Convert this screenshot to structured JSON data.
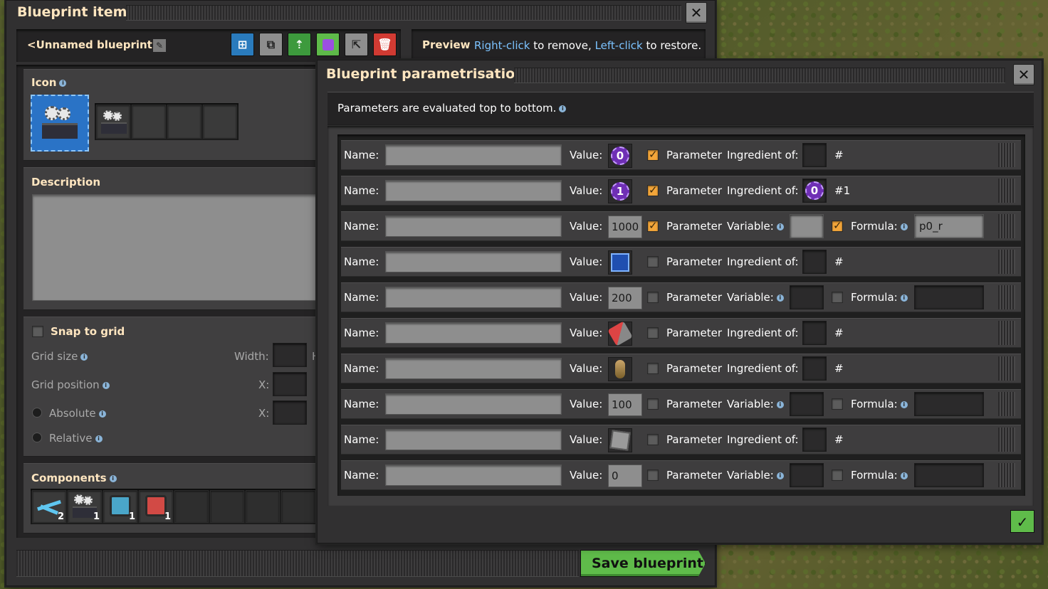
{
  "bp_window": {
    "title": "Blueprint item",
    "close": "✕",
    "blueprint_name": "<Unnamed blueprint>",
    "preview_label": "Preview",
    "preview_right_click": "Right-click",
    "preview_mid": "to remove,",
    "preview_left_click": "Left-click",
    "preview_end": "to restore.",
    "icon_header": "Icon",
    "description_header": "Description",
    "snap_to_grid": "Snap to grid",
    "grid_size": "Grid size",
    "width_label": "Width:",
    "h_label": "H",
    "grid_position": "Grid position",
    "x_label": "X:",
    "absolute": "Absolute",
    "relative": "Relative",
    "components_header": "Components",
    "components": [
      {
        "icon": "inserter-icon",
        "count": "2"
      },
      {
        "icon": "assembler-icon",
        "count": "1"
      },
      {
        "icon": "blue-machine-icon",
        "count": "1"
      },
      {
        "icon": "red-machine-icon",
        "count": "1"
      }
    ],
    "save_button": "Save blueprint"
  },
  "param_window": {
    "title": "Blueprint parametrisation",
    "close": "✕",
    "hint": "Parameters are evaluated top to bottom.",
    "confirm": "✓",
    "labels": {
      "name": "Name:",
      "value": "Value:",
      "parameter": "Parameter",
      "ingredient_of": "Ingredient of:",
      "variable": "Variable:",
      "formula": "Formula:",
      "hash": "#"
    },
    "rows": [
      {
        "value_type": "signal",
        "value": "0",
        "parameter": true,
        "mode": "ingredient",
        "ingredient_value": "",
        "hash": "#"
      },
      {
        "value_type": "signal",
        "value": "1",
        "parameter": true,
        "mode": "ingredient",
        "ingredient_value": "0",
        "hash": "#1"
      },
      {
        "value_type": "number",
        "value": "1000",
        "parameter": true,
        "mode": "variable",
        "variable_checked": true,
        "formula": "p0_r"
      },
      {
        "value_type": "item",
        "value_icon": "blueprint-combinator-icon",
        "parameter": false,
        "mode": "ingredient",
        "hash": "#"
      },
      {
        "value_type": "number",
        "value": "200",
        "parameter": false,
        "mode": "variable",
        "variable_checked": false,
        "formula": ""
      },
      {
        "value_type": "item",
        "value_icon": "red-ammo-icon",
        "parameter": false,
        "mode": "ingredient",
        "hash": "#"
      },
      {
        "value_type": "item",
        "value_icon": "ampule-icon",
        "parameter": false,
        "mode": "ingredient",
        "hash": "#"
      },
      {
        "value_type": "number",
        "value": "100",
        "parameter": false,
        "mode": "variable",
        "variable_checked": false,
        "formula": ""
      },
      {
        "value_type": "item",
        "value_icon": "stone-brick-icon",
        "parameter": false,
        "mode": "ingredient",
        "hash": "#"
      },
      {
        "value_type": "number",
        "value": "0",
        "parameter": false,
        "mode": "variable",
        "variable_checked": false,
        "formula": ""
      }
    ]
  }
}
